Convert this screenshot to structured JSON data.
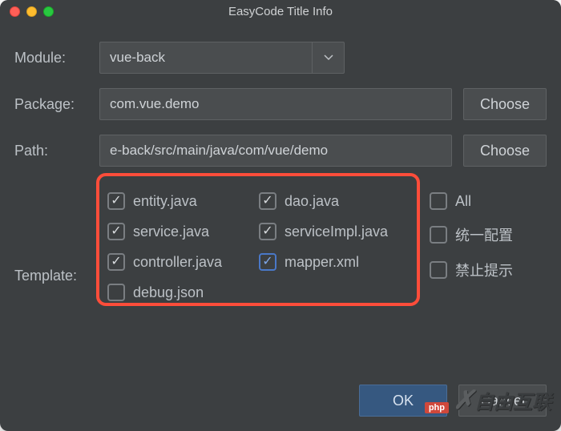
{
  "window": {
    "title": "EasyCode Title Info"
  },
  "form": {
    "module": {
      "label": "Module:",
      "value": "vue-back"
    },
    "package": {
      "label": "Package:",
      "value": "com.vue.demo",
      "choose": "Choose"
    },
    "path": {
      "label": "Path:",
      "value": "e-back/src/main/java/com/vue/demo",
      "choose": "Choose"
    },
    "template": {
      "label": "Template:"
    }
  },
  "templates": [
    {
      "name": "entity.java",
      "checked": true
    },
    {
      "name": "dao.java",
      "checked": true
    },
    {
      "name": "service.java",
      "checked": true
    },
    {
      "name": "serviceImpl.java",
      "checked": true
    },
    {
      "name": "controller.java",
      "checked": true
    },
    {
      "name": "mapper.xml",
      "checked": true,
      "highlight": true
    },
    {
      "name": "debug.json",
      "checked": false
    }
  ],
  "options": {
    "all": {
      "label": "All",
      "checked": false
    },
    "unified": {
      "label": "统一配置",
      "checked": false
    },
    "suppress": {
      "label": "禁止提示",
      "checked": false
    }
  },
  "footer": {
    "ok": "OK",
    "cancel": "Cancel"
  },
  "watermark": {
    "text": "自由互联",
    "php": "php"
  }
}
